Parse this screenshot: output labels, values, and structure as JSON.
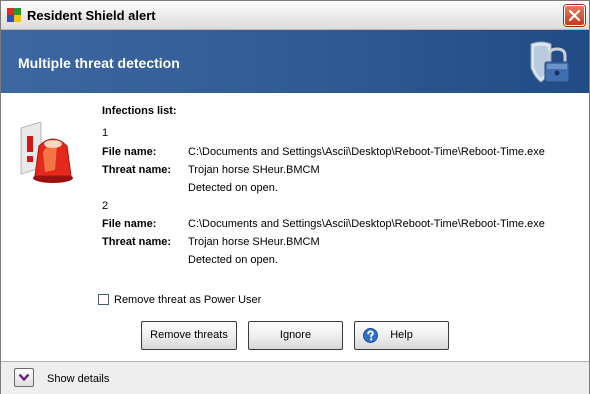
{
  "window": {
    "title": "Resident Shield alert",
    "icon": "avg-logo-icon",
    "close_icon": "close-icon"
  },
  "header": {
    "title": "Multiple threat detection",
    "icon": "shield-lock-icon"
  },
  "alert_icon": "alarm-siren-icon",
  "infections": {
    "heading": "Infections list:",
    "file_label": "File name:",
    "threat_label": "Threat name:",
    "items": [
      {
        "index": "1",
        "file_name": "C:\\Documents and Settings\\Ascii\\Desktop\\Reboot-Time\\Reboot-Time.exe",
        "threat_name": "Trojan horse SHeur.BMCM",
        "detection": "Detected on open."
      },
      {
        "index": "2",
        "file_name": "C:\\Documents and Settings\\Ascii\\Desktop\\Reboot-Time\\Reboot-Time.exe",
        "threat_name": "Trojan horse SHeur.BMCM",
        "detection": "Detected on open."
      }
    ]
  },
  "options": {
    "power_user_label": "Remove threat as Power User",
    "power_user_checked": false
  },
  "buttons": {
    "remove": "Remove threats",
    "ignore": "Ignore",
    "help": "Help",
    "help_icon": "help-question-icon"
  },
  "footer": {
    "show_details": "Show details",
    "toggle_icon": "chevron-down-icon"
  },
  "colors": {
    "header_blue": "#2f5a93",
    "close_red": "#c63a1b",
    "chevron_purple": "#6b1f7a"
  }
}
